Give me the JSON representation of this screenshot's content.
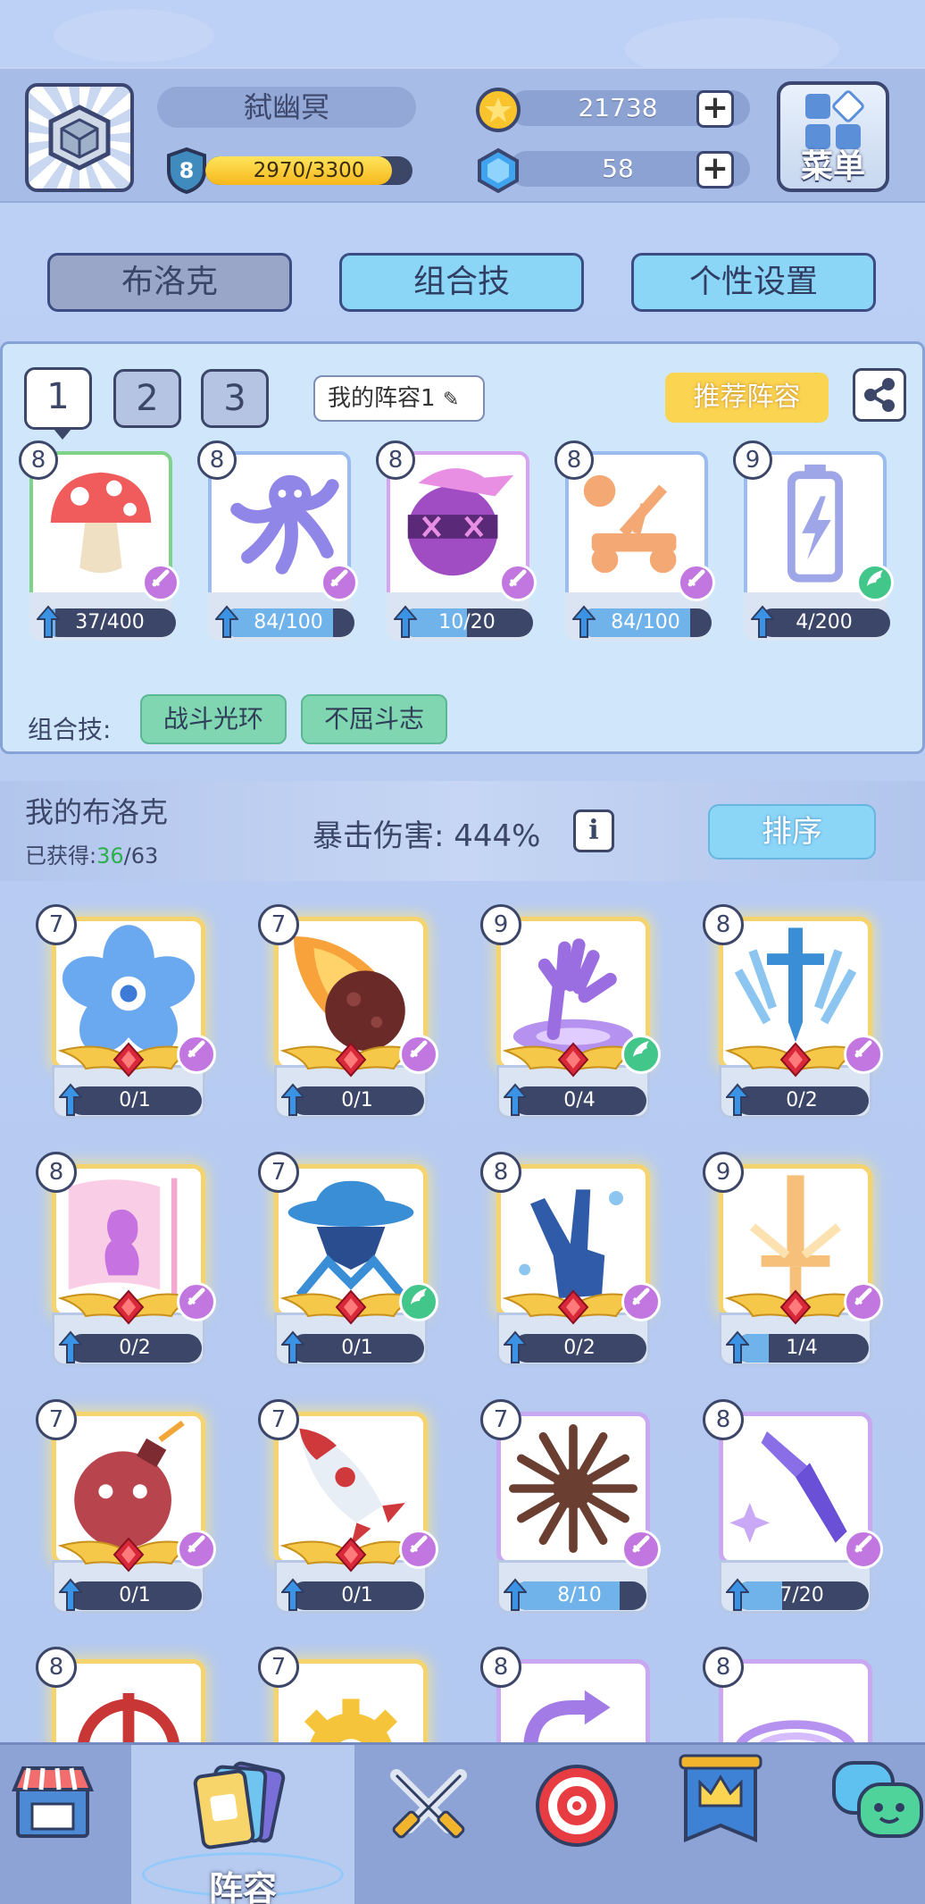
{
  "player": {
    "name": "弑幽冥",
    "level": "8",
    "xp_text": "2970/3300",
    "xp_fraction": 0.9
  },
  "resources": {
    "coins": "21738",
    "gems": "58",
    "plus": "+"
  },
  "menu": {
    "label": "菜单"
  },
  "tabs": [
    {
      "label": "布洛克"
    },
    {
      "label": "组合技"
    },
    {
      "label": "个性设置"
    }
  ],
  "team": {
    "slots": [
      "1",
      "2",
      "3"
    ],
    "lineup_name": "我的阵容1",
    "recommend_label": "推荐阵容",
    "cards": [
      {
        "level": "8",
        "progress": "37/400",
        "fraction": 0.09,
        "type": "attack",
        "art": "mushroom-icon",
        "color": "#7fd289"
      },
      {
        "level": "8",
        "progress": "84/100",
        "fraction": 0.84,
        "type": "attack",
        "art": "octopus-icon",
        "color": "#9bbcf0"
      },
      {
        "level": "8",
        "progress": "10/20",
        "fraction": 0.5,
        "type": "attack",
        "art": "ninja-ball-icon",
        "color": "#d6a4f0"
      },
      {
        "level": "8",
        "progress": "84/100",
        "fraction": 0.84,
        "type": "attack",
        "art": "catapult-icon",
        "color": "#9bbcf0"
      },
      {
        "level": "9",
        "progress": "4/200",
        "fraction": 0.02,
        "type": "support",
        "art": "battery-icon",
        "color": "#9bbcf0"
      }
    ],
    "combo_label": "组合技:",
    "combos": [
      "战斗光环",
      "不屈斗志"
    ]
  },
  "my_brock": {
    "title": "我的布洛克",
    "obtained_label": "已获得:",
    "obtained_count": "36",
    "obtained_total": "/63",
    "crit_text": "暴击伤害: 444%",
    "info": "i",
    "sort_label": "排序"
  },
  "grid": [
    {
      "level": "7",
      "progress": "0/1",
      "fraction": 0,
      "type": "attack",
      "art": "flower-icon",
      "gold": true
    },
    {
      "level": "7",
      "progress": "0/1",
      "fraction": 0,
      "type": "attack",
      "art": "meteor-icon",
      "gold": true
    },
    {
      "level": "9",
      "progress": "0/4",
      "fraction": 0,
      "type": "support",
      "art": "hand-portal-icon",
      "gold": true
    },
    {
      "level": "8",
      "progress": "0/2",
      "fraction": 0,
      "type": "attack",
      "art": "sword-icon",
      "gold": true
    },
    {
      "level": "8",
      "progress": "0/2",
      "fraction": 0,
      "type": "attack",
      "art": "flag-icon",
      "gold": true
    },
    {
      "level": "7",
      "progress": "0/1",
      "fraction": 0,
      "type": "support",
      "art": "spy-icon",
      "gold": true
    },
    {
      "level": "8",
      "progress": "0/2",
      "fraction": 0,
      "type": "attack",
      "art": "peace-hand-icon",
      "gold": true
    },
    {
      "level": "9",
      "progress": "1/4",
      "fraction": 0.25,
      "type": "attack",
      "art": "holy-sword-icon",
      "gold": true
    },
    {
      "level": "7",
      "progress": "0/1",
      "fraction": 0,
      "type": "attack",
      "art": "bomb-icon",
      "gold": true
    },
    {
      "level": "7",
      "progress": "0/1",
      "fraction": 0,
      "type": "attack",
      "art": "rocket-icon",
      "gold": true
    },
    {
      "level": "7",
      "progress": "8/10",
      "fraction": 0.8,
      "type": "attack",
      "art": "burst-icon",
      "gold": false
    },
    {
      "level": "8",
      "progress": "7/20",
      "fraction": 0.35,
      "type": "attack",
      "art": "crystal-dagger-icon",
      "gold": false
    },
    {
      "level": "8",
      "progress": "",
      "fraction": 0,
      "type": "attack",
      "art": "crosshair-icon",
      "gold": true
    },
    {
      "level": "7",
      "progress": "",
      "fraction": 0,
      "type": "attack",
      "art": "gear-icon",
      "gold": true
    },
    {
      "level": "8",
      "progress": "",
      "fraction": 0,
      "type": "attack",
      "art": "cycle-arrow-icon",
      "gold": false
    },
    {
      "level": "8",
      "progress": "",
      "fraction": 0,
      "type": "attack",
      "art": "vortex-icon",
      "gold": false
    }
  ],
  "nav": {
    "lineup_label": "阵容"
  },
  "colors": {
    "attack_badge": "#c277e0",
    "support_badge": "#43c68a",
    "tab_active": "#8bd5f7"
  }
}
